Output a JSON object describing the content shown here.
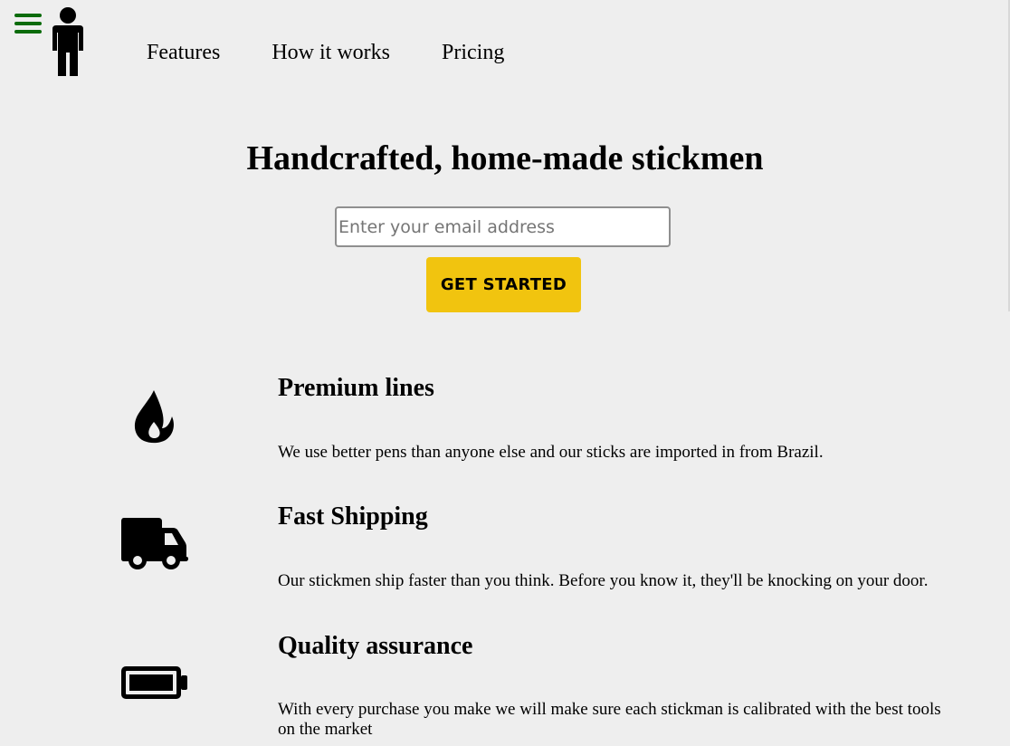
{
  "header": {
    "menu_icon": "hamburger-menu-icon",
    "logo_icon": "stickman-logo-icon",
    "nav": [
      {
        "label": "Features"
      },
      {
        "label": "How it works"
      },
      {
        "label": "Pricing"
      }
    ]
  },
  "hero": {
    "title": "Handcrafted, home-made stickmen",
    "email_placeholder": "Enter your email address",
    "cta_label": "GET STARTED"
  },
  "features": [
    {
      "icon": "fire-icon",
      "title": "Premium lines",
      "description": "We use better pens than anyone else and our sticks are imported in from Brazil."
    },
    {
      "icon": "truck-icon",
      "title": "Fast Shipping",
      "description": "Our stickmen ship faster than you think. Before you know it, they'll be knocking on your door."
    },
    {
      "icon": "battery-full-icon",
      "title": "Quality assurance",
      "description": "With every purchase you make we will make sure each stickman is calibrated with the best tools on the market"
    }
  ],
  "colors": {
    "background": "#eeeeee",
    "menu_icon": "#0b6b0b",
    "cta_background": "#f1c40f"
  }
}
